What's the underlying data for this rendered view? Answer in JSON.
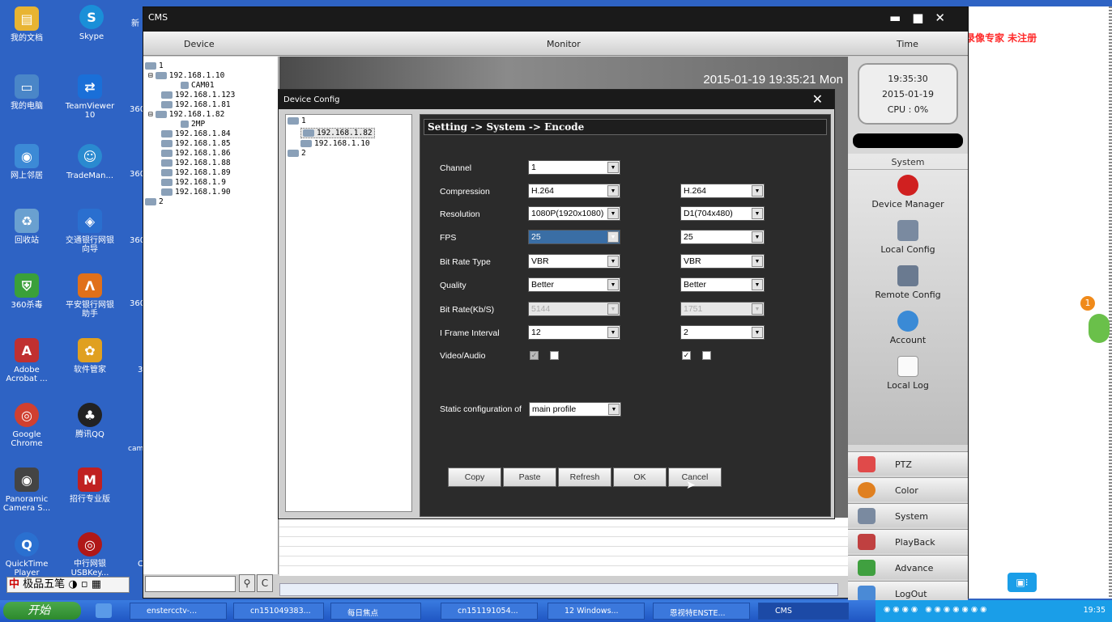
{
  "desktop": {
    "icons": [
      {
        "label": "我的文档",
        "color": "#e8b432"
      },
      {
        "label": "Skype",
        "color": "#1a8fd8"
      },
      {
        "label": "我的电脑",
        "color": "#4a86c8"
      },
      {
        "label": "TeamViewer 10",
        "color": "#1a6fd8"
      },
      {
        "label": "网上邻居",
        "color": "#3c8ad6"
      },
      {
        "label": "TradeMan...",
        "color": "#2a8ad0"
      },
      {
        "label": "回收站",
        "color": "#6aa0d0"
      },
      {
        "label": "交通银行网银向导",
        "color": "#2a6fcf"
      },
      {
        "label": "360杀毒",
        "color": "#3aa03a"
      },
      {
        "label": "平安银行网银助手",
        "color": "#e0701a"
      },
      {
        "label": "Adobe Acrobat ...",
        "color": "#c03030"
      },
      {
        "label": "软件管家",
        "color": "#e0a020"
      },
      {
        "label": "Google Chrome",
        "color": "#d04030"
      },
      {
        "label": "腾讯QQ",
        "color": "#222222"
      },
      {
        "label": "Panoramic Camera S...",
        "color": "#444444"
      },
      {
        "label": "招行专业版",
        "color": "#c02020"
      },
      {
        "label": "QuickTime Player",
        "color": "#2a70d0"
      },
      {
        "label": "中行网银 USBKey...",
        "color": "#b01818"
      }
    ],
    "partial_labels": [
      "新",
      "360",
      "360",
      "360",
      "360",
      "3",
      "cam",
      "C"
    ],
    "watermark": "屏幕录像专家 未注册"
  },
  "cms": {
    "title": "CMS",
    "header": {
      "device": "Device",
      "monitor": "Monitor",
      "time": "Time"
    },
    "tree": [
      {
        "label": "1",
        "indent": 0
      },
      {
        "label": "192.168.1.10",
        "indent": 1
      },
      {
        "label": "CAM01",
        "indent": 2
      },
      {
        "label": "192.168.1.123",
        "indent": 1
      },
      {
        "label": "192.168.1.81",
        "indent": 1
      },
      {
        "label": "192.168.1.82",
        "indent": 1
      },
      {
        "label": "2MP",
        "indent": 2
      },
      {
        "label": "192.168.1.84",
        "indent": 1
      },
      {
        "label": "192.168.1.85",
        "indent": 1
      },
      {
        "label": "192.168.1.86",
        "indent": 1
      },
      {
        "label": "192.168.1.88",
        "indent": 1
      },
      {
        "label": "192.168.1.89",
        "indent": 1
      },
      {
        "label": "192.168.1.9",
        "indent": 1
      },
      {
        "label": "192.168.1.90",
        "indent": 1
      },
      {
        "label": "2",
        "indent": 0
      }
    ],
    "video_timestamp": "2015-01-19 19:35:21 Mon",
    "clock": {
      "time": "19:35:30",
      "date": "2015-01-19",
      "cpu": "CPU : 0%"
    },
    "system_panel": {
      "title": "System",
      "items": [
        "Device Manager",
        "Local Config",
        "Remote Config",
        "Account",
        "Local Log"
      ]
    },
    "menu": [
      "PTZ",
      "Color",
      "System",
      "PlayBack",
      "Advance",
      "LogOut"
    ]
  },
  "dialog": {
    "title": "Device Config",
    "tree": [
      "1",
      "192.168.1.82",
      "192.168.1.10",
      "2"
    ],
    "breadcrumb": "Setting -> System -> Encode",
    "labels": {
      "channel": "Channel",
      "compression": "Compression",
      "resolution": "Resolution",
      "fps": "FPS",
      "bitrate_type": "Bit Rate Type",
      "quality": "Quality",
      "bitrate": "Bit Rate(Kb/S)",
      "iframe": "I Frame Interval",
      "video_audio": "Video/Audio",
      "static_config": "Static configuration of"
    },
    "main": {
      "channel": "1",
      "compression": "H.264",
      "resolution": "1080P(1920x1080)",
      "fps": "25",
      "bitrate_type": "VBR",
      "quality": "Better",
      "bitrate": "5144",
      "iframe": "12"
    },
    "extra": {
      "compression": "H.264",
      "resolution": "D1(704x480)",
      "fps": "25",
      "bitrate_type": "VBR",
      "quality": "Better",
      "bitrate": "1751",
      "iframe": "2"
    },
    "static_value": "main profile",
    "buttons": {
      "copy": "Copy",
      "paste": "Paste",
      "refresh": "Refresh",
      "ok": "OK",
      "cancel": "Cancel"
    }
  },
  "taskbar": {
    "start": "开始",
    "ime": "极品五笔",
    "items": [
      "enstercctv-...",
      "cn151049383...",
      "每日焦点",
      "cn151191054...",
      "12 Windows...",
      "恩视特ENSTE...",
      "CMS"
    ],
    "clock": "19:35"
  },
  "colors": {
    "accent": "#3a6ea5",
    "watermark": "#ff2a2a"
  }
}
